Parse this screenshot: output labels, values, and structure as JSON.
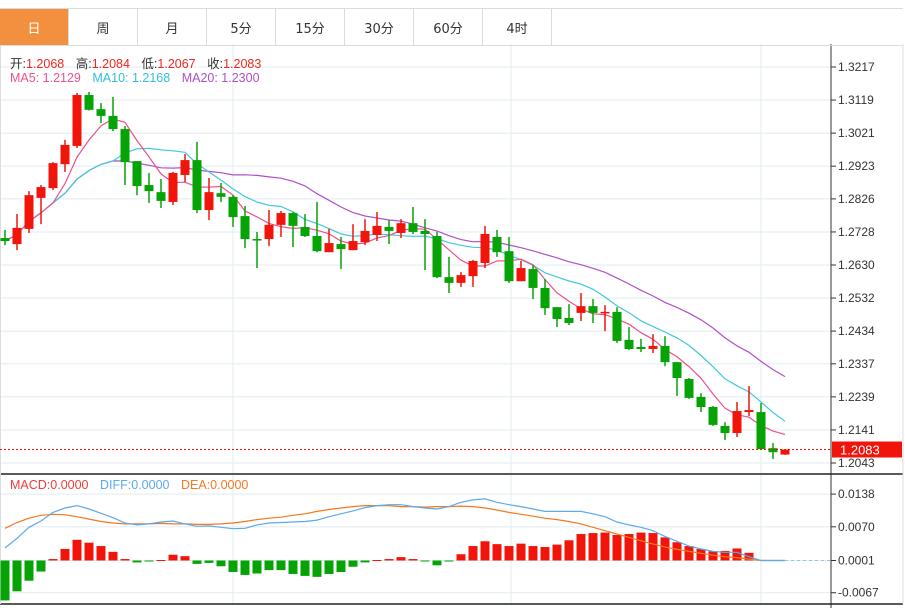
{
  "tabs": [
    {
      "label": "日",
      "active": true
    },
    {
      "label": "周"
    },
    {
      "label": "月"
    },
    {
      "label": "5分"
    },
    {
      "label": "15分"
    },
    {
      "label": "30分"
    },
    {
      "label": "60分"
    },
    {
      "label": "4时"
    }
  ],
  "ohlc_legend": {
    "open_label": "开:",
    "open": "1.2068",
    "high_label": "高:",
    "high": "1.2084",
    "low_label": "低:",
    "low": "1.2067",
    "close_label": "收:",
    "close": "1.2083"
  },
  "ma_legend": {
    "ma5": "MA5: 1.2129",
    "ma10": "MA10: 1.2168",
    "ma20": "MA20: 1.2300"
  },
  "macd_legend": {
    "macd": "MACD:0.0000",
    "diff": "DIFF:0.0000",
    "dea": "DEA:0.0000"
  },
  "colors": {
    "up": "#f0140a",
    "down": "#05a305",
    "ma5": "#f0508c",
    "ma10": "#40c8dc",
    "ma20": "#b050c8",
    "diff": "#5aaaf0",
    "dea": "#f57820",
    "tab_active": "#f39040"
  },
  "current_price": "1.2083",
  "chart_data": {
    "type": "candlestick",
    "price_axis": {
      "ticks": [
        "1.3217",
        "1.3119",
        "1.3021",
        "1.2923",
        "1.2826",
        "1.2728",
        "1.2630",
        "1.2532",
        "1.2434",
        "1.2337",
        "1.2239",
        "1.2141",
        "1.2043"
      ],
      "range": [
        1.2043,
        1.3217
      ]
    },
    "macd_axis": {
      "ticks": [
        "0.0138",
        "0.0070",
        "0.0001",
        "-0.0067"
      ]
    },
    "candles": [
      [
        1.271,
        1.2701,
        1.2734,
        1.2689
      ],
      [
        1.2692,
        1.274,
        1.2781,
        1.2674
      ],
      [
        1.2737,
        1.2837,
        1.2849,
        1.2725
      ],
      [
        1.2829,
        1.2861,
        1.2867,
        1.2751
      ],
      [
        1.2858,
        1.2932,
        1.2935,
        1.2852
      ],
      [
        1.2929,
        1.2986,
        1.3001,
        1.2906
      ],
      [
        1.2983,
        1.3134,
        1.314,
        1.2977
      ],
      [
        1.3134,
        1.309,
        1.3143,
        1.3088
      ],
      [
        1.3092,
        1.3072,
        1.311,
        1.3051
      ],
      [
        1.3072,
        1.3033,
        1.3128,
        1.3027
      ],
      [
        1.3033,
        1.2935,
        1.3042,
        1.2867
      ],
      [
        1.2938,
        1.2864,
        1.2938,
        1.2837
      ],
      [
        1.2867,
        1.2849,
        1.2903,
        1.2814
      ],
      [
        1.2846,
        1.282,
        1.2885,
        1.2799
      ],
      [
        1.2817,
        1.2903,
        1.2906,
        1.2808
      ],
      [
        1.2897,
        1.2941,
        1.2959,
        1.2876
      ],
      [
        1.2941,
        1.2793,
        1.2995,
        1.2784
      ],
      [
        1.2793,
        1.2846,
        1.2888,
        1.2763
      ],
      [
        1.2843,
        1.2832,
        1.2873,
        1.2817
      ],
      [
        1.2832,
        1.2772,
        1.2837,
        1.2743
      ],
      [
        1.2775,
        1.2707,
        1.2805,
        1.268
      ],
      [
        1.2707,
        1.2706,
        1.2728,
        1.2621
      ],
      [
        1.2707,
        1.2749,
        1.2793,
        1.2686
      ],
      [
        1.2749,
        1.2784,
        1.279,
        1.2713
      ],
      [
        1.2784,
        1.2746,
        1.2787,
        1.2683
      ],
      [
        1.2743,
        1.2716,
        1.2781,
        1.2713
      ],
      [
        1.2716,
        1.2671,
        1.2817,
        1.2668
      ],
      [
        1.2668,
        1.2695,
        1.2737,
        1.2668
      ],
      [
        1.2692,
        1.2677,
        1.2713,
        1.2618
      ],
      [
        1.2674,
        1.2701,
        1.2751,
        1.2674
      ],
      [
        1.2698,
        1.2731,
        1.2766,
        1.2689
      ],
      [
        1.2719,
        1.2746,
        1.2787,
        1.2701
      ],
      [
        1.2743,
        1.2731,
        1.2763,
        1.2692
      ],
      [
        1.2725,
        1.2754,
        1.2766,
        1.271
      ],
      [
        1.2754,
        1.2728,
        1.2802,
        1.2722
      ],
      [
        1.2731,
        1.2722,
        1.2766,
        1.2615
      ],
      [
        1.2716,
        1.2594,
        1.2728,
        1.2591
      ],
      [
        1.2594,
        1.2577,
        1.2654,
        1.2547
      ],
      [
        1.2577,
        1.26,
        1.2609,
        1.2565
      ],
      [
        1.2597,
        1.2642,
        1.2645,
        1.2565
      ],
      [
        1.2636,
        1.2722,
        1.2746,
        1.2621
      ],
      [
        1.2713,
        1.2668,
        1.2734,
        1.2654
      ],
      [
        1.2671,
        1.2582,
        1.2713,
        1.2577
      ],
      [
        1.2582,
        1.2621,
        1.2642,
        1.2582
      ],
      [
        1.2618,
        1.2562,
        1.263,
        1.2529
      ],
      [
        1.2562,
        1.2502,
        1.2588,
        1.2482
      ],
      [
        1.2505,
        1.247,
        1.2505,
        1.2446
      ],
      [
        1.2473,
        1.2458,
        1.2514,
        1.2452
      ],
      [
        1.2488,
        1.2508,
        1.2547,
        1.2464
      ],
      [
        1.2508,
        1.2488,
        1.2529,
        1.2458
      ],
      [
        1.2488,
        1.2491,
        1.2511,
        1.2434
      ],
      [
        1.2491,
        1.2405,
        1.2505,
        1.2399
      ],
      [
        1.2408,
        1.2381,
        1.2446,
        1.2378
      ],
      [
        1.2387,
        1.2381,
        1.2411,
        1.2372
      ],
      [
        1.2381,
        1.239,
        1.2425,
        1.2369
      ],
      [
        1.239,
        1.2342,
        1.2419,
        1.233
      ],
      [
        1.2342,
        1.2295,
        1.2342,
        1.2242
      ],
      [
        1.2292,
        1.2236,
        1.2295,
        1.2233
      ],
      [
        1.2239,
        1.2209,
        1.225,
        1.2194
      ],
      [
        1.2209,
        1.2156,
        1.2212,
        1.2153
      ],
      [
        1.2153,
        1.2132,
        1.2164,
        1.2111
      ],
      [
        1.2132,
        1.2197,
        1.2224,
        1.212
      ],
      [
        1.2194,
        1.22,
        1.2271,
        1.2182
      ],
      [
        1.2194,
        1.2084,
        1.2221,
        1.2084
      ],
      [
        1.2087,
        1.2075,
        1.2102,
        1.2055
      ],
      [
        1.2068,
        1.2083,
        1.2084,
        1.2067
      ]
    ],
    "macd_hist": [
      -0.0083,
      -0.0064,
      -0.0042,
      -0.0023,
      0.0003,
      0.0024,
      0.0043,
      0.0037,
      0.003,
      0.0018,
      0.0003,
      -0.0004,
      -0.0002,
      0.0001,
      0.0012,
      0.0009,
      -0.0007,
      -0.0005,
      -0.0012,
      -0.0024,
      -0.003,
      -0.0027,
      -0.002,
      -0.002,
      -0.0028,
      -0.0032,
      -0.0034,
      -0.0028,
      -0.0024,
      -0.0013,
      -0.0004,
      0.0001,
      0.0003,
      0.0007,
      0.0003,
      -0.0002,
      -0.001,
      -0.0002,
      0.0013,
      0.003,
      0.004,
      0.0034,
      0.003,
      0.0035,
      0.003,
      0.0028,
      0.0033,
      0.0042,
      0.0055,
      0.0057,
      0.0058,
      0.0053,
      0.0055,
      0.0058,
      0.0057,
      0.0048,
      0.0038,
      0.003,
      0.0024,
      0.0019,
      0.002,
      0.0025,
      0.0016,
      0,
      0,
      0
    ],
    "diff": [
      0.0026,
      0.0046,
      0.0069,
      0.0082,
      0.01,
      0.0109,
      0.0114,
      0.0107,
      0.0098,
      0.0089,
      0.0078,
      0.0074,
      0.0076,
      0.008,
      0.0082,
      0.0076,
      0.0071,
      0.0072,
      0.0069,
      0.0066,
      0.0067,
      0.0074,
      0.0078,
      0.0079,
      0.008,
      0.0081,
      0.0084,
      0.0091,
      0.0097,
      0.0103,
      0.011,
      0.0114,
      0.0116,
      0.0116,
      0.0112,
      0.0109,
      0.0107,
      0.0112,
      0.0121,
      0.0126,
      0.0128,
      0.0121,
      0.0116,
      0.0112,
      0.0107,
      0.0102,
      0.0102,
      0.0102,
      0.0102,
      0.0097,
      0.0091,
      0.008,
      0.0074,
      0.0069,
      0.0062,
      0.005,
      0.004,
      0.003,
      0.0024,
      0.0019,
      0.0017,
      0.0017,
      0.0008,
      0,
      0,
      0
    ],
    "dea": [
      0.0067,
      0.0079,
      0.0088,
      0.0094,
      0.0096,
      0.0095,
      0.0091,
      0.0086,
      0.0081,
      0.0078,
      0.0076,
      0.0076,
      0.0076,
      0.0077,
      0.0076,
      0.0076,
      0.0075,
      0.0075,
      0.0076,
      0.0078,
      0.0081,
      0.0085,
      0.0088,
      0.009,
      0.0094,
      0.0097,
      0.0102,
      0.0106,
      0.0109,
      0.0112,
      0.0114,
      0.0114,
      0.0114,
      0.0112,
      0.0112,
      0.0111,
      0.0112,
      0.0112,
      0.0113,
      0.0112,
      0.0109,
      0.0105,
      0.01,
      0.0096,
      0.0092,
      0.0088,
      0.0085,
      0.0081,
      0.0076,
      0.0069,
      0.0062,
      0.0055,
      0.0048,
      0.0041,
      0.0034,
      0.0028,
      0.0023,
      0.0019,
      0.0015,
      0.0011,
      0.0008,
      0.0006,
      0.0003,
      0,
      0,
      0
    ]
  }
}
